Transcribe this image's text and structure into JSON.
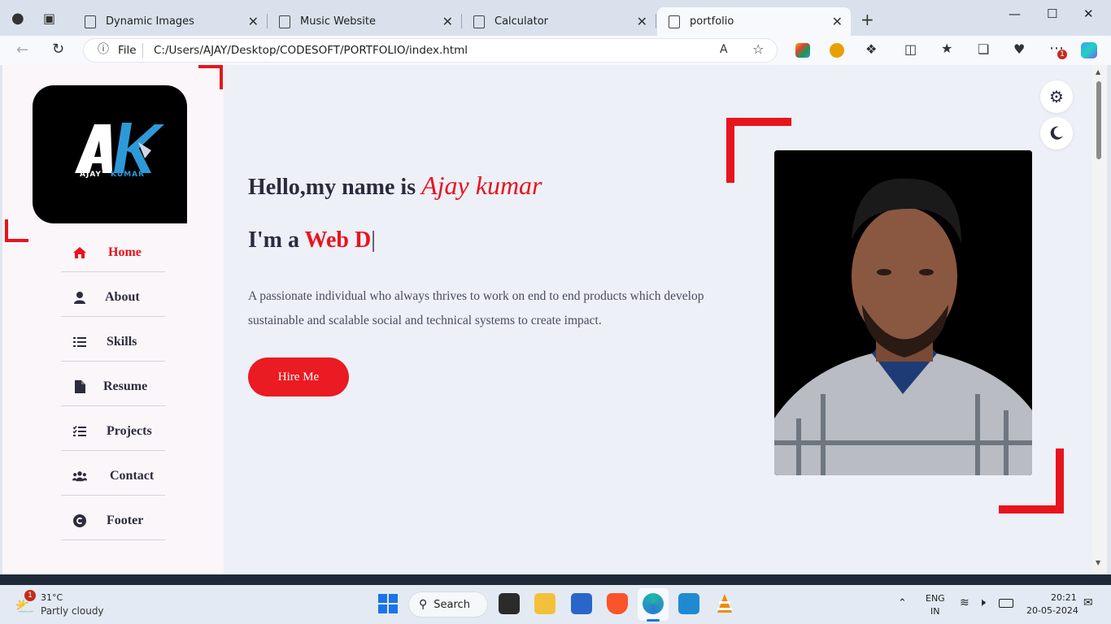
{
  "browser": {
    "tabs": [
      {
        "label": "Dynamic Images",
        "active": false
      },
      {
        "label": "Music Website",
        "active": false
      },
      {
        "label": "Calculator",
        "active": false
      },
      {
        "label": "portfolio",
        "active": true
      }
    ],
    "address": {
      "scheme_label": "File",
      "url": "C:/Users/AJAY/Desktop/CODESOFT/PORTFOLIO/index.html"
    },
    "extension_badge": "1"
  },
  "sidebar": {
    "logo": {
      "initials": "AK",
      "name_left": "AJAY",
      "name_right": "KUMAR"
    },
    "nav": [
      {
        "label": "Home",
        "icon": "home-icon",
        "active": true
      },
      {
        "label": "About",
        "icon": "user-icon",
        "active": false
      },
      {
        "label": "Skills",
        "icon": "list-icon",
        "active": false
      },
      {
        "label": "Resume",
        "icon": "file-icon",
        "active": false
      },
      {
        "label": "Projects",
        "icon": "tasks-icon",
        "active": false
      },
      {
        "label": "Contact",
        "icon": "users-icon",
        "active": false
      },
      {
        "label": "Footer",
        "icon": "copyright-icon",
        "active": false
      }
    ]
  },
  "hero": {
    "greeting": "Hello,my name is ",
    "name": "Ajay kumar",
    "role_prefix": "I'm a ",
    "role_typed": "Web D",
    "cursor": "|",
    "description": "A passionate individual who always thrives to work on end to end products which develop sustainable and scalable social and technical systems to create impact.",
    "cta": "Hire Me"
  },
  "theme": {
    "accent": "#e8141d",
    "text_dark": "#2b2b3f",
    "page_bg": "#eef0f8",
    "sidebar_bg": "#fbf6fa"
  },
  "taskbar": {
    "weather": {
      "temp": "31°C",
      "condition": "Partly cloudy",
      "badge": "1"
    },
    "search_label": "Search",
    "lang": "ENG",
    "region": "IN",
    "time": "20:21",
    "date": "20-05-2024"
  }
}
